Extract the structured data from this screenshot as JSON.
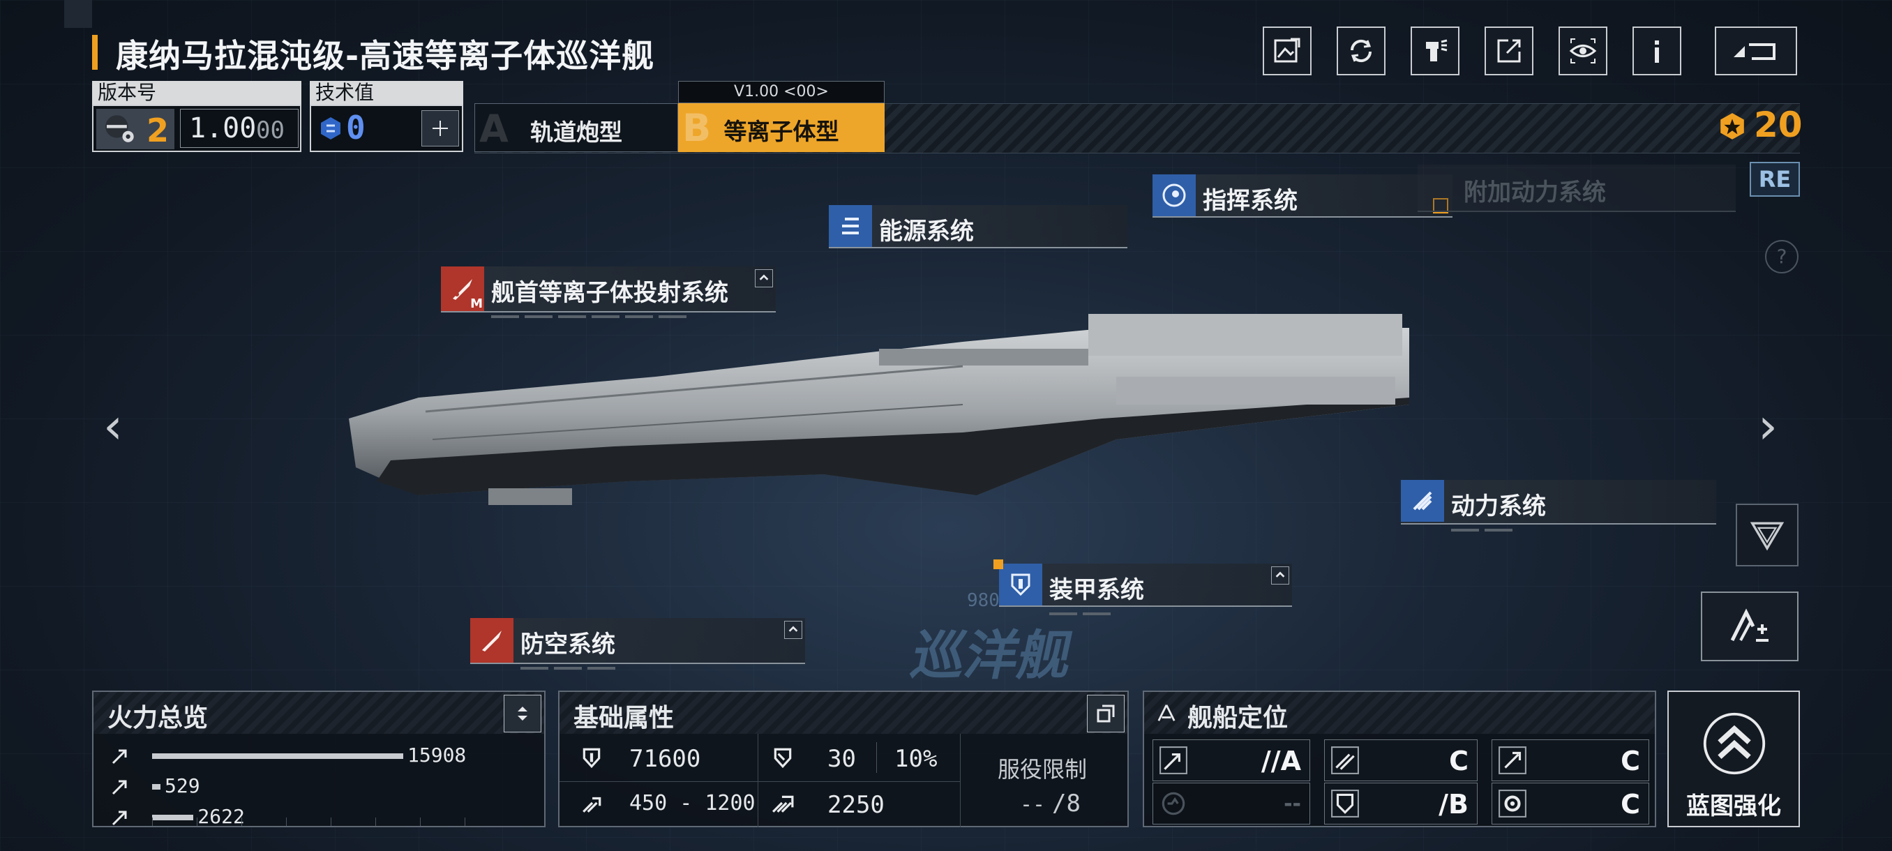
{
  "ship": {
    "title": "康纳马拉混沌级-高速等离子体巡洋舰"
  },
  "version": {
    "label": "版本号",
    "level": "2",
    "value": "1.00",
    "sub": "00"
  },
  "tech": {
    "label": "技术值",
    "value": "0"
  },
  "types": {
    "tag": "V1.00 <00>",
    "a": {
      "letter": "A",
      "label": "轨道炮型"
    },
    "b": {
      "letter": "B",
      "label": "等离子体型"
    }
  },
  "currency": {
    "value": "20",
    "color": "#f0a020"
  },
  "re_label": "RE",
  "help_label": "?",
  "systems": {
    "command": "指挥系统",
    "aux_power": "附加动力系统",
    "energy": "能源系统",
    "bow_plasma": "舰首等离子体投射系统",
    "bow_badge": "M",
    "power": "动力系统",
    "armor": "装甲系统",
    "aa": "防空系统"
  },
  "ground_text": {
    "class": "巡洋舰",
    "code": "980"
  },
  "firepower": {
    "title": "火力总览",
    "rows": [
      {
        "value": "15908",
        "fraction": 1.0
      },
      {
        "value": "529",
        "fraction": 0.033
      },
      {
        "value": "2622",
        "fraction": 0.165
      }
    ]
  },
  "base": {
    "title": "基础属性",
    "hp": "71600",
    "armor": "30",
    "armor_pct": "10%",
    "speed": "450 - 1200",
    "warp": "2250",
    "service_label": "服役限制",
    "service_cur": "--",
    "service_max": "/8"
  },
  "position": {
    "title": "舰船定位",
    "grades": [
      "//A",
      "C",
      "C",
      "--",
      "/B",
      "C"
    ]
  },
  "upgrade": {
    "label": "蓝图强化"
  },
  "accent": "#f0a020",
  "icons": [
    "share-icon",
    "refresh-icon",
    "paint-icon",
    "export-icon",
    "view-icon",
    "info-icon",
    "back-icon"
  ]
}
